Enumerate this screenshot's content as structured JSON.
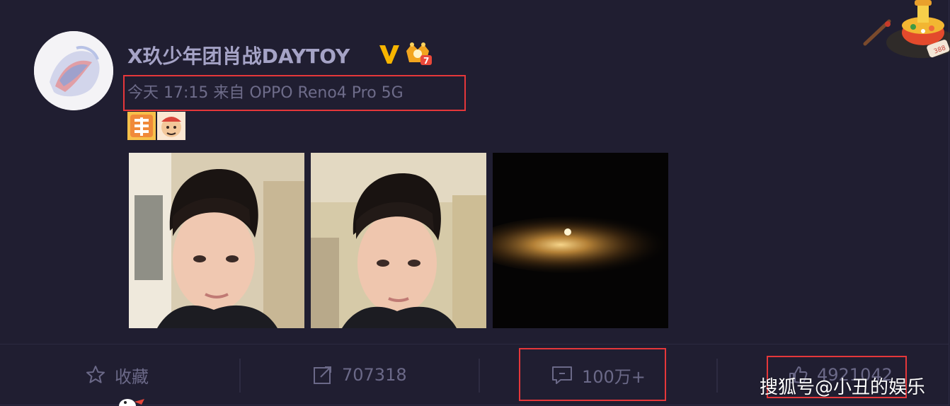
{
  "post": {
    "username": "X玖少年团肖战DAYTOY",
    "timestamp": "今天 17:15",
    "source": "来自 OPPO Reno4 Pro 5G",
    "verified_icon": "verified-v-icon",
    "member_icon": "member-crown-icon",
    "member_level": "7"
  },
  "emojis": [
    "zan-sticker",
    "mascot-sticker"
  ],
  "photos": [
    {
      "name": "selfie-photo-1"
    },
    {
      "name": "selfie-photo-2"
    },
    {
      "name": "night-light-photo"
    }
  ],
  "actions": {
    "favorite_label": "收藏",
    "repost_count": "707318",
    "comment_count": "100万+",
    "like_count": "4921042"
  },
  "watermark": "搜狐号@小丑的娱乐",
  "colors": {
    "background": "#201e31",
    "highlight": "#e5373a",
    "verified": "#f7b500",
    "username": "#a5a3c6"
  }
}
